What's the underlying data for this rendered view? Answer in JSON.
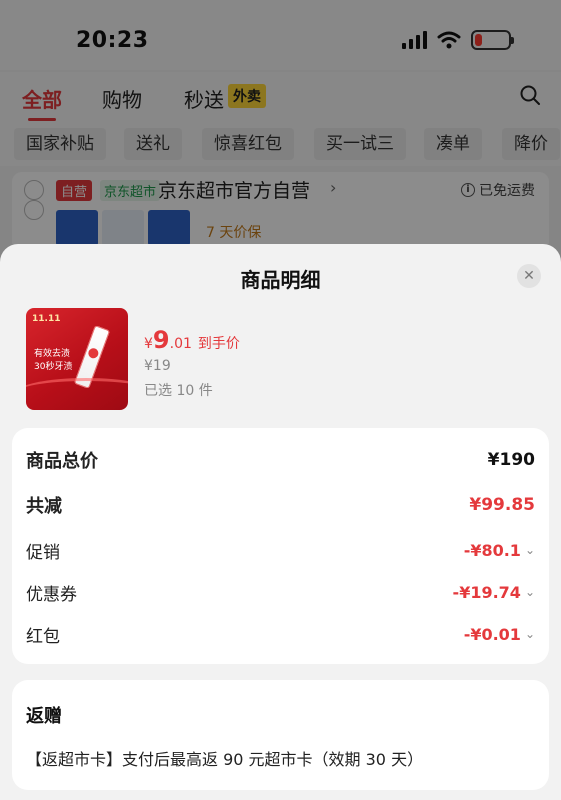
{
  "status_bar": {
    "time": "20:23",
    "battery_color": "#ff3b30"
  },
  "top_tabs": {
    "items": [
      {
        "label": "全部"
      },
      {
        "label": "购物"
      },
      {
        "label": "秒送"
      }
    ],
    "badge": "外卖"
  },
  "filters": {
    "items": [
      {
        "label": "国家补贴"
      },
      {
        "label": "送礼"
      },
      {
        "label": "惊喜红包"
      },
      {
        "label": "买一试三"
      },
      {
        "label": "凑单"
      },
      {
        "label": "降价"
      }
    ]
  },
  "store": {
    "self_badge": "自营",
    "super_badge": "京东超市",
    "name": "京东超市官方自营",
    "free_shipping": "已免运费",
    "price_protect": "7 天价保"
  },
  "sheet": {
    "title": "商品明细",
    "close_icon": "close-icon"
  },
  "product": {
    "currency": "¥",
    "price_int": "9",
    "price_dec": ".01",
    "price_tag": "到手价",
    "original_price": "¥19",
    "selected": "已选 10 件",
    "image_top_text": "11.11",
    "image_text_1": "有效去渍",
    "image_text_2": "30秒牙渍"
  },
  "breakdown": {
    "total": {
      "label": "商品总价",
      "value": "¥190"
    },
    "reduced": {
      "label": "共减",
      "value": "¥99.85"
    },
    "promotion": {
      "label": "促销",
      "value": "-¥80.1"
    },
    "coupon": {
      "label": "优惠券",
      "value": "-¥19.74"
    },
    "red_packet": {
      "label": "红包",
      "value": "-¥0.01"
    }
  },
  "gift": {
    "title": "返赠",
    "description": "【返超市卡】支付后最高返 90 元超市卡（效期 30 天）"
  },
  "colors": {
    "accent": "#e4393c",
    "sheet_bg": "#f2f2f2"
  }
}
